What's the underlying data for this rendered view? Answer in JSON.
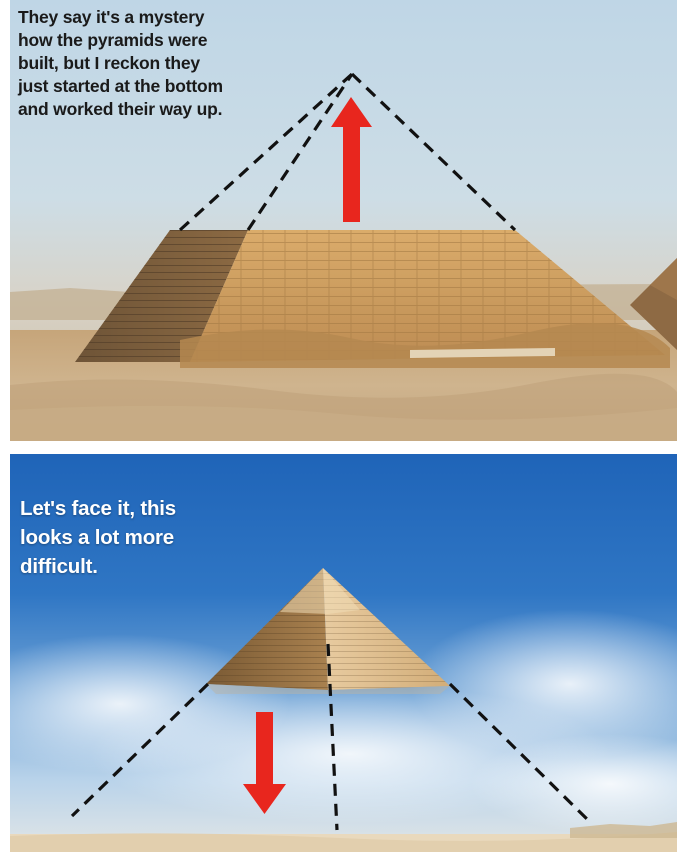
{
  "top_panel": {
    "caption": "They say it's a mystery\nhow the pyramids were\nbuilt, but I reckon they\njust started at the bottom\nand worked their way up.",
    "arrow_direction": "up",
    "arrow_icon": "red-arrow-up-icon",
    "colors": {
      "arrow": "#e8261e",
      "sky": "#c9dbe6",
      "stone": "#c89a55",
      "sand": "#cdb08a"
    }
  },
  "bottom_panel": {
    "caption": "Let's face it, this\nlooks a lot more\ndifficult.",
    "arrow_direction": "down",
    "arrow_icon": "red-arrow-down-icon",
    "colors": {
      "arrow": "#e8261e",
      "sky": "#2a6fc0",
      "stone": "#d1ac74",
      "caption_text": "#ffffff"
    }
  }
}
